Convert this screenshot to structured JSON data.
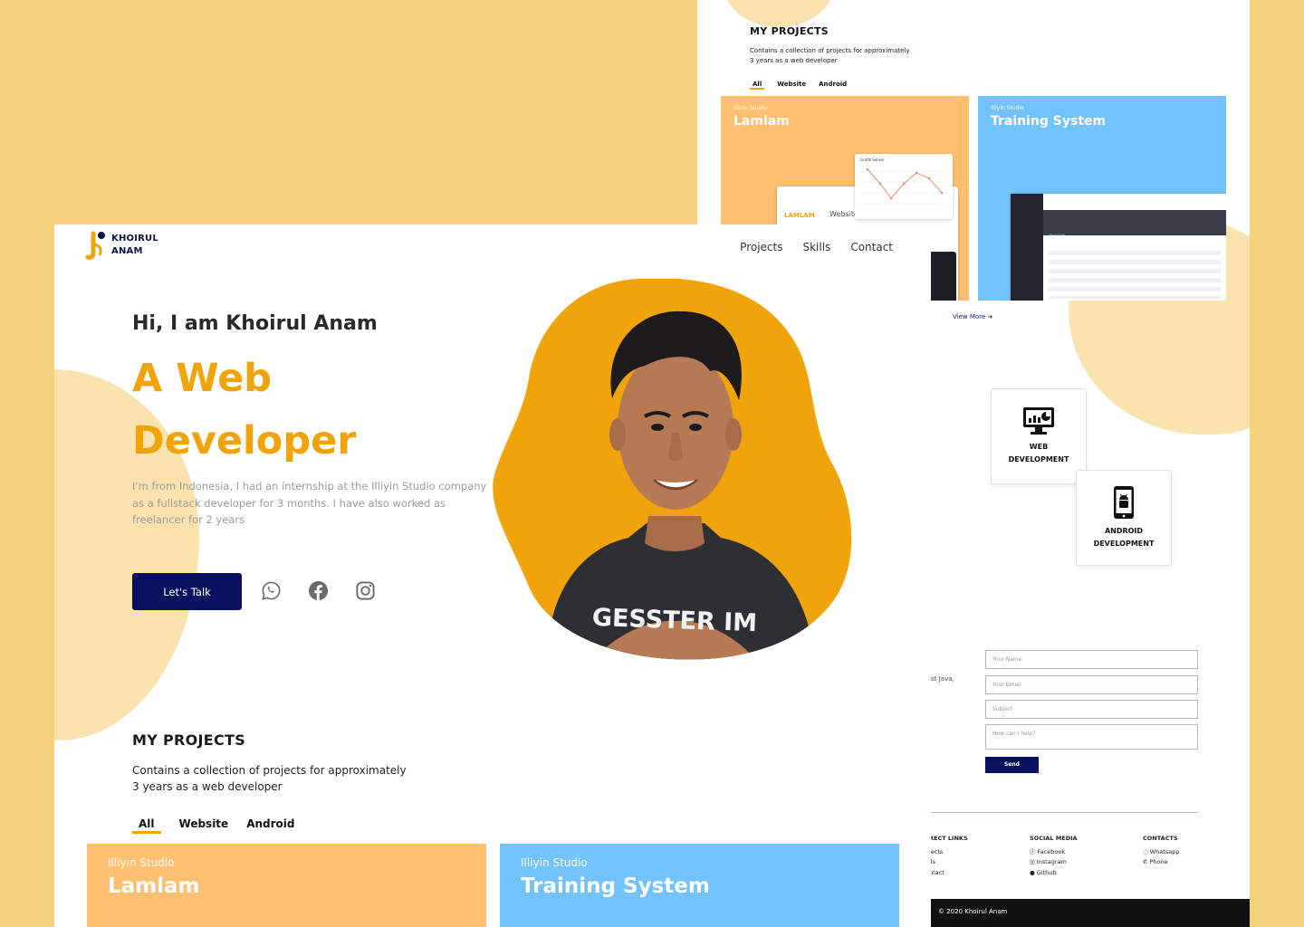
{
  "back": {
    "projects": {
      "title": "MY PROJECTS",
      "desc_line1": "Contains a collection of projects for approximately",
      "desc_line2": "3 years as a web developer",
      "tabs": [
        "All",
        "Website",
        "Android"
      ],
      "cards": [
        {
          "company": "Illiyin Studio",
          "name": "Lamlam"
        },
        {
          "company": "Illiyin Studio",
          "name": "Training System"
        }
      ],
      "mock_chart_title": "Grafik Server",
      "mock_logo": "LAMLAM",
      "mock_caption": "Website P",
      "mock_user_list": "User List",
      "view_more": "View More"
    },
    "skills": [
      {
        "line1": "WEB",
        "line2": "DEVELOPMENT",
        "icon": "monitor-chart-icon"
      },
      {
        "line1": "ANDROID",
        "line2": "DEVELOPMENT",
        "icon": "android-phone-icon"
      }
    ],
    "contact": {
      "side_text": "st Java,",
      "placeholders": {
        "name": "Your Name",
        "email": "Your Email",
        "subject": "Subject",
        "message": "How can I help?"
      },
      "send_label": "Send"
    },
    "footer": {
      "direct_links": {
        "heading": "RECT LINKS",
        "items": [
          "jects",
          "lls",
          "ntact"
        ]
      },
      "social_media": {
        "heading": "SOCIAL MEDIA",
        "items": [
          "Facebook",
          "Instagram",
          "Github"
        ]
      },
      "contacts": {
        "heading": "CONTACTS",
        "items": [
          "Whatsapp",
          "Phone"
        ]
      },
      "copyright": "© 2020 Khoirul Anam"
    }
  },
  "front": {
    "logo": {
      "line1": "KHOIRUL",
      "line2": "ANAM"
    },
    "nav": [
      "Projects",
      "Skills",
      "Contact"
    ],
    "hero": {
      "greeting": "Hi, I am Khoirul Anam",
      "role_line1": "A Web",
      "role_line2": "Developer",
      "intro": "I'm from Indonesia, I had an internship at the Illiyin Studio company as a fullstack developer for 3 months. I have also worked as freelancer for 2 years",
      "cta": "Let's Talk",
      "socials": [
        "whatsapp-icon",
        "facebook-icon",
        "instagram-icon"
      ],
      "shirt_text": "GESSTER IM"
    },
    "projects": {
      "title": "MY PROJECTS",
      "desc_line1": "Contains a collection of projects for approximately",
      "desc_line2": "3 years as a web developer",
      "tabs": [
        "All",
        "Website",
        "Android"
      ],
      "cards": [
        {
          "company": "Illiyin Studio",
          "name": "Lamlam"
        },
        {
          "company": "Illiyin Studio",
          "name": "Training System"
        }
      ]
    }
  },
  "colors": {
    "background": "#f5d37e",
    "accent": "#f0a30a",
    "navy": "#08115e",
    "card_orange": "#ffbf70",
    "card_blue": "#72c2fb",
    "blob": "#fbe3b0"
  }
}
